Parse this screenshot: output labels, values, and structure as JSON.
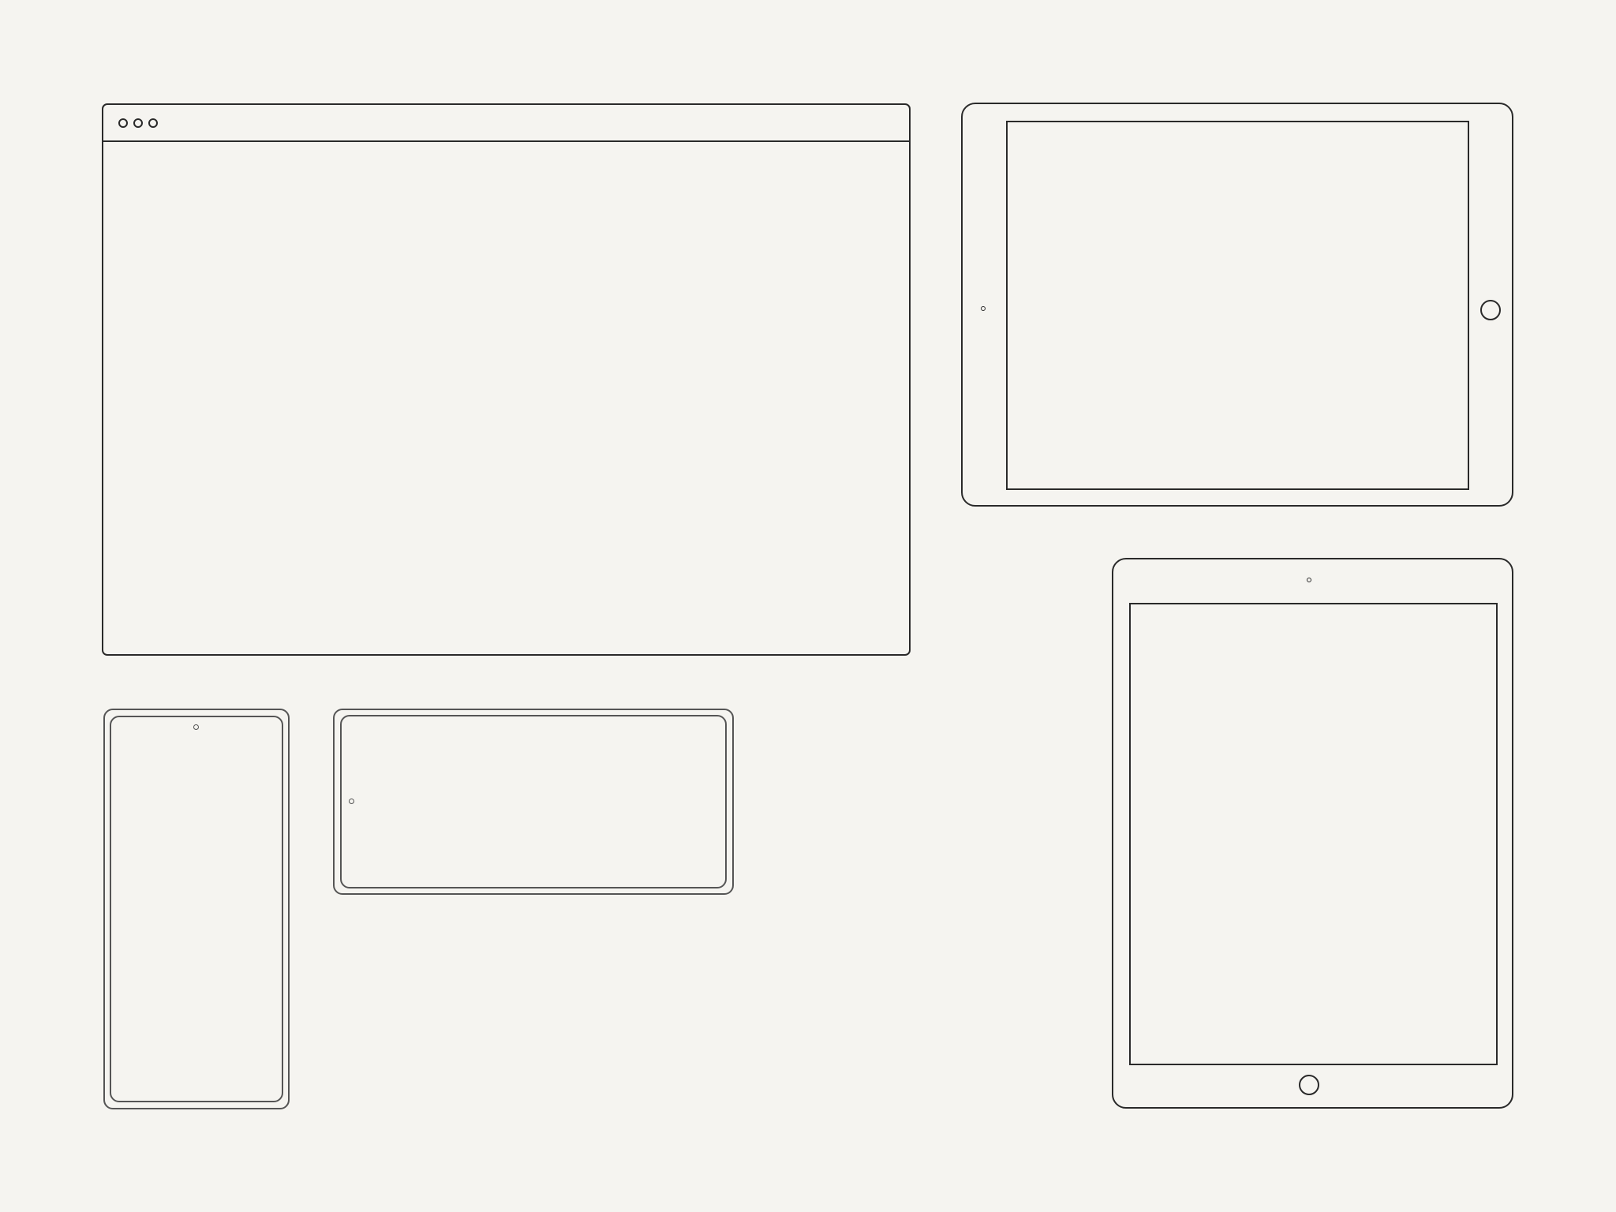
{
  "canvas": {
    "background_color": "#f5f4f0",
    "stroke_color": "#2a2a2a",
    "phone_stroke_color": "#555555"
  },
  "devices": [
    {
      "type": "browser-window",
      "controls": [
        "close-dot",
        "minimize-dot",
        "maximize-dot"
      ]
    },
    {
      "type": "tablet",
      "orientation": "landscape",
      "features": [
        "camera",
        "home-button"
      ]
    },
    {
      "type": "tablet",
      "orientation": "portrait",
      "features": [
        "camera",
        "home-button"
      ]
    },
    {
      "type": "phone",
      "orientation": "portrait",
      "features": [
        "camera"
      ]
    },
    {
      "type": "phone",
      "orientation": "landscape",
      "features": [
        "camera"
      ]
    }
  ]
}
